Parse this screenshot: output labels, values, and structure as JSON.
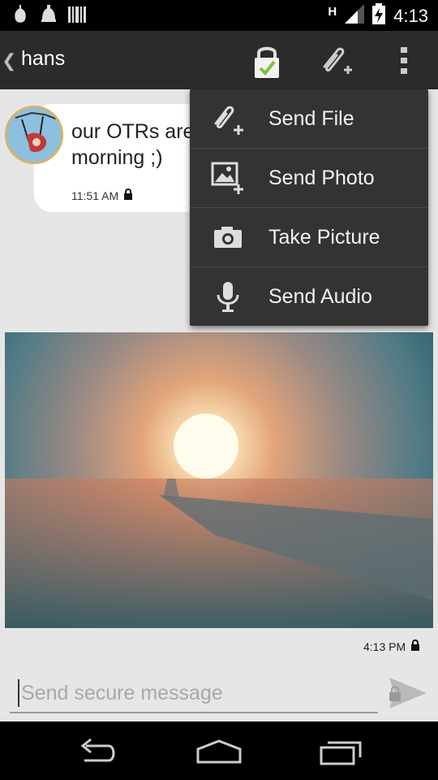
{
  "status_bar": {
    "time": "4:13",
    "network_type": "H",
    "icons": [
      "android-icon",
      "bug-icon",
      "barcode-icon",
      "signal-icon",
      "battery-charging-icon"
    ]
  },
  "action_bar": {
    "title": "hans",
    "icons": [
      "back-chevron-icon",
      "otr-lock-verified-icon",
      "attach-icon",
      "overflow-menu-icon"
    ]
  },
  "messages": [
    {
      "text": "our OTRs are\nmorning ;)",
      "time": "11:51 AM",
      "lock": "lock-icon"
    },
    {
      "type": "photo",
      "time": "4:13 PM",
      "lock": "lock-icon"
    }
  ],
  "composer": {
    "placeholder": "Send secure message",
    "value": ""
  },
  "popup_menu": {
    "items": [
      {
        "label": "Send File",
        "icon": "attach-file-icon"
      },
      {
        "label": "Send Photo",
        "icon": "image-add-icon"
      },
      {
        "label": "Take Picture",
        "icon": "camera-icon"
      },
      {
        "label": "Send Audio",
        "icon": "microphone-icon"
      }
    ]
  },
  "nav_bar": {
    "icons": [
      "back-icon",
      "home-icon",
      "recent-apps-icon"
    ]
  },
  "colors": {
    "status_bar": "#000000",
    "action_bar": "#2b2b2b",
    "popup": "#333333",
    "background": "#e6e6e6",
    "verified_check": "#7cc242",
    "avatar_border": "#d8b26a"
  }
}
